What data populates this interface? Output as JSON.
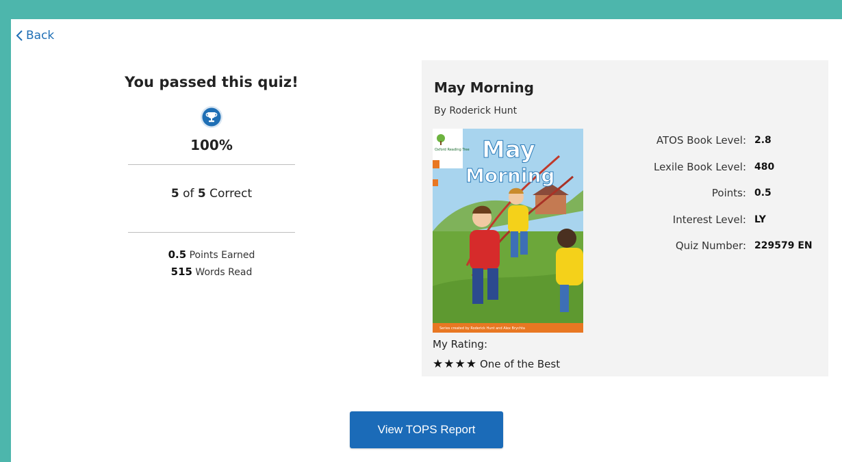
{
  "colors": {
    "background": "#4db6ac",
    "link": "#1f6fb5",
    "button": "#1b6bb8",
    "trophy": "#1f6fb5"
  },
  "nav": {
    "back_label": "Back",
    "back_icon": "chevron-left-icon"
  },
  "result": {
    "title": "You passed this quiz!",
    "icon": "trophy-icon",
    "percent": "100%",
    "correct_count": "5",
    "of_text": "of",
    "total": "5",
    "correct_text": "Correct",
    "points_value": "0.5",
    "points_label": "Points Earned",
    "words_value": "515",
    "words_label": "Words Read"
  },
  "book": {
    "title": "May Morning",
    "author": "By Roderick Hunt",
    "cover": {
      "title_line1": "May",
      "title_line2": "Morning",
      "publisher": "Oxford Reading Tree",
      "credits": "Series created by Roderick Hunt and Alex Brychta"
    },
    "rating_label": "My Rating:",
    "rating_stars": 4,
    "rating_text": "One of the Best",
    "details": [
      {
        "label": "ATOS Book Level:",
        "value": "2.8"
      },
      {
        "label": "Lexile Book Level:",
        "value": "480"
      },
      {
        "label": "Points:",
        "value": "0.5"
      },
      {
        "label": "Interest Level:",
        "value": "LY"
      },
      {
        "label": "Quiz Number:",
        "value": "229579 EN"
      }
    ]
  },
  "actions": {
    "tops_button": "View TOPS Report"
  }
}
